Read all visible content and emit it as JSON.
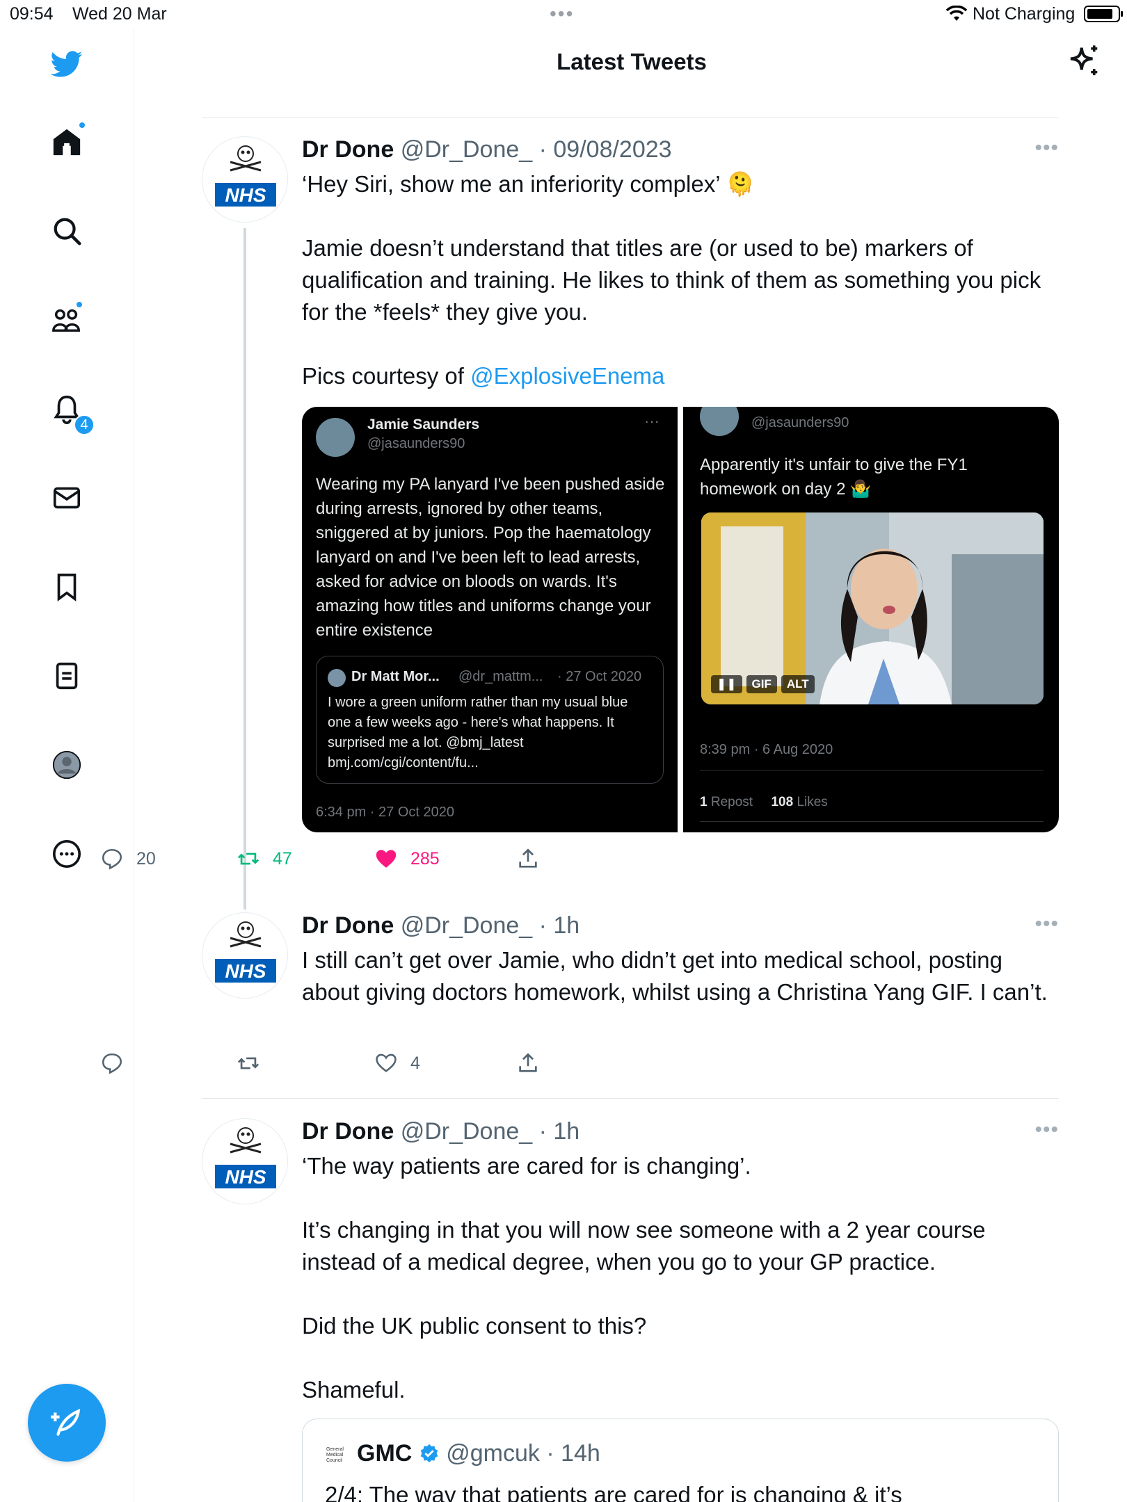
{
  "status_bar": {
    "time": "09:54",
    "date": "Wed 20 Mar",
    "charging": "Not Charging"
  },
  "sidebar": {
    "notification_count": "4",
    "accent": "#1d9bf0"
  },
  "header": {
    "title": "Latest Tweets"
  },
  "tweets": [
    {
      "name": "Dr Done",
      "meta": "@Dr_Done_ · 09/08/2023",
      "line1": "‘Hey Siri, show me an inferiority complex’ 🫠",
      "para2": "Jamie doesn’t understand that titles are (or used to be) markers of qualification and training. He likes to think of them as something you pick for the *feels* they give you.",
      "credit_prefix": "Pics courtesy of ",
      "credit_link": "@ExplosiveEnema",
      "avatar_label": "NHS",
      "replies": "20",
      "retweets": "47",
      "likes": "285",
      "media": {
        "left": {
          "name": "Jamie Saunders",
          "handle": "@jasaunders90",
          "text": "Wearing my PA lanyard I've been pushed aside during arrests, ignored by other teams, sniggered at by juniors. Pop the haematology lanyard on and I've been left to lead arrests, asked for advice on bloods on wards. It's amazing how titles and uniforms change your entire existence",
          "quote_name": "Dr Matt Mor...",
          "quote_handle": "@dr_mattm...",
          "quote_date": "· 27 Oct 2020",
          "quote_text": "I wore a green uniform rather than my usual blue one a few weeks ago - here's what happens. It surprised me a lot. @bmj_latest bmj.com/cgi/content/fu...",
          "time": "6:34 pm · 27 Oct 2020"
        },
        "right": {
          "handle": "@jasaunders90",
          "text": "Apparently it's unfair to give the FY1 homework on day 2 🤷‍♂️",
          "gif_label": "GIF",
          "alt_label": "ALT",
          "time": "8:39 pm · 6 Aug 2020",
          "reposts_count": "1",
          "reposts_label": "Repost",
          "likes_count": "108",
          "likes_label": "Likes"
        }
      }
    },
    {
      "name": "Dr Done",
      "meta": "@Dr_Done_ · 1h",
      "text": "I still can’t get over Jamie, who didn’t get into medical school, posting about giving doctors homework, whilst using a Christina Yang GIF. I can’t.",
      "avatar_label": "NHS",
      "likes": "4"
    },
    {
      "name": "Dr Done",
      "meta": "@Dr_Done_ · 1h",
      "p1": "‘The way patients are cared for is changing’.",
      "p2": "It’s changing in that you will now see someone with a 2 year course instead of a medical degree, when you go to your GP practice.",
      "p3": "Did the UK public consent to this?",
      "p4": "Shameful.",
      "avatar_label": "NHS",
      "quoted": {
        "logo_text": "General Medical Council",
        "name": "GMC",
        "meta": "@gmcuk · 14h",
        "text": "2/4: The way that patients are cared for is changing & it’s"
      }
    }
  ]
}
